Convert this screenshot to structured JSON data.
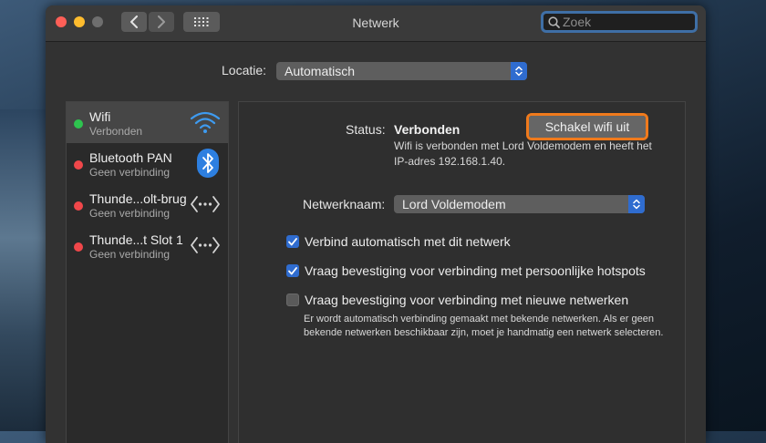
{
  "window": {
    "title": "Netwerk",
    "search_placeholder": "Zoek"
  },
  "location": {
    "label": "Locatie:",
    "value": "Automatisch"
  },
  "services": [
    {
      "name": "Wifi",
      "status": "Verbonden",
      "connected": true,
      "icon": "wifi-icon"
    },
    {
      "name": "Bluetooth PAN",
      "status": "Geen verbinding",
      "connected": false,
      "icon": "bluetooth-icon"
    },
    {
      "name": "Thunde...olt-brug",
      "status": "Geen verbinding",
      "connected": false,
      "icon": "ethernet-arrows-icon"
    },
    {
      "name": "Thunde...t Slot  1",
      "status": "Geen verbinding",
      "connected": false,
      "icon": "ethernet-arrows-icon"
    }
  ],
  "detail": {
    "status_label": "Status:",
    "status_value": "Verbonden",
    "toggle_button": "Schakel wifi uit",
    "status_description": "Wifi is verbonden met Lord Voldemodem en heeft het IP-adres 192.168.1.40.",
    "network_name_label": "Netwerknaam:",
    "network_name_value": "Lord Voldemodem",
    "options": [
      {
        "label": "Verbind automatisch met dit netwerk",
        "checked": true
      },
      {
        "label": "Vraag bevestiging voor verbinding met persoonlijke hotspots",
        "checked": true
      },
      {
        "label": "Vraag bevestiging voor verbinding met nieuwe netwerken",
        "checked": false
      }
    ],
    "footnote": "Er wordt automatisch verbinding gemaakt met bekende netwerken. Als er geen bekende netwerken beschikbaar zijn, moet je handmatig een netwerk selecteren."
  },
  "colors": {
    "accent": "#2f6ccf",
    "connected": "#2ec44f",
    "disconnected": "#f0474a",
    "highlight": "#f07a1c"
  }
}
